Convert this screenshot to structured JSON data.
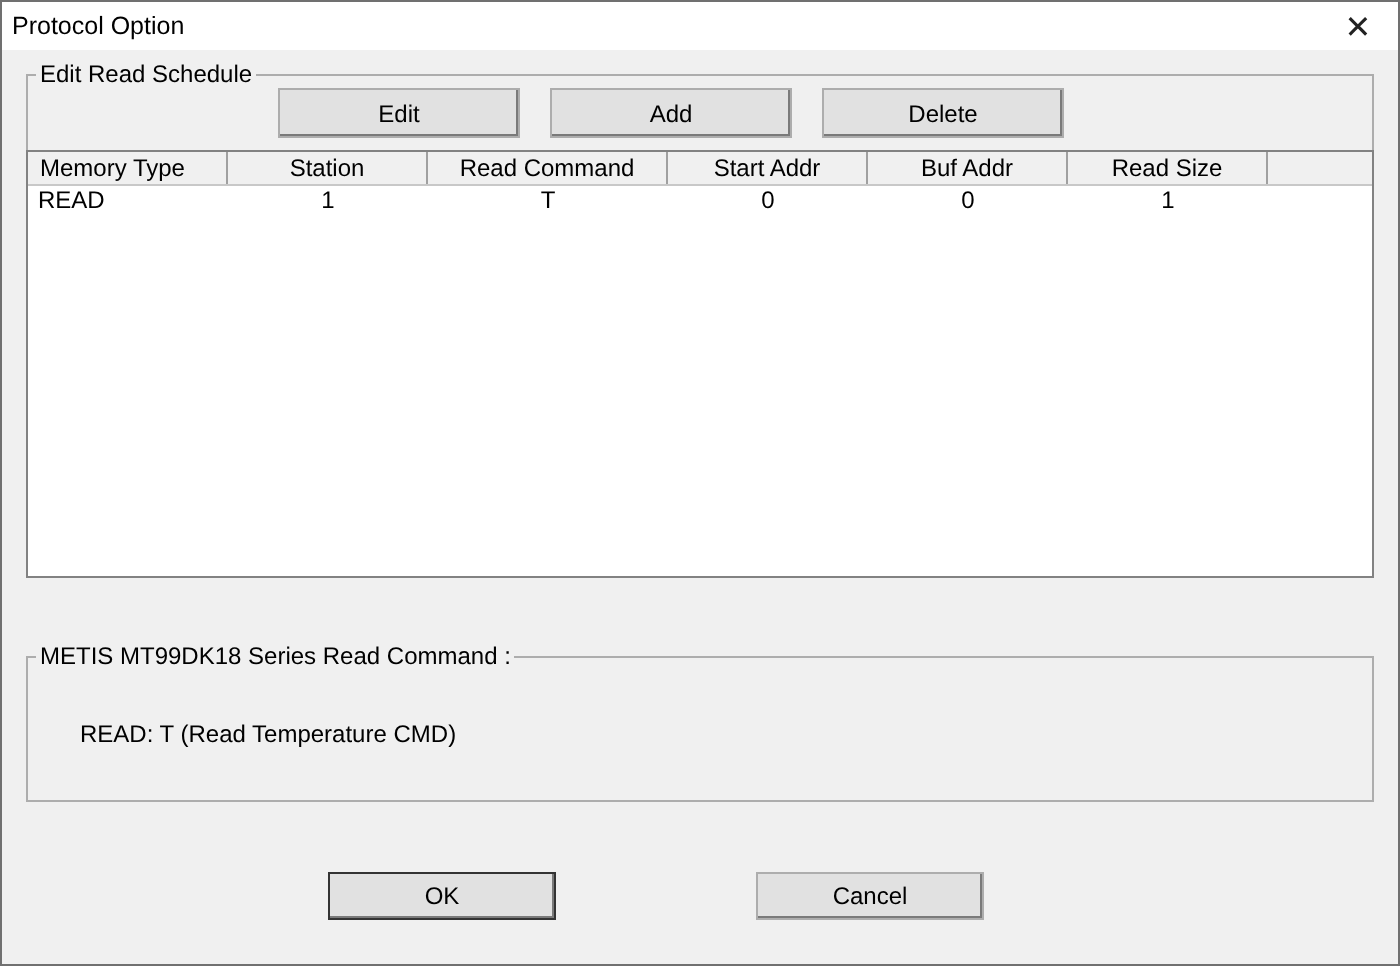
{
  "window": {
    "title": "Protocol Option",
    "close": "✕"
  },
  "schedule": {
    "legend": "Edit Read Schedule",
    "buttons": [
      "Edit",
      "Add",
      "Delete"
    ],
    "columns": [
      "Memory Type",
      "Station",
      "Read Command",
      "Start Addr",
      "Buf Addr",
      "Read Size"
    ],
    "rows": [
      [
        "READ",
        "1",
        "T",
        "0",
        "0",
        "1"
      ]
    ]
  },
  "info": {
    "legend": "METIS MT99DK18 Series Read Command :",
    "text": "READ: T (Read Temperature CMD)"
  },
  "buttons": [
    "OK",
    "Cancel"
  ]
}
